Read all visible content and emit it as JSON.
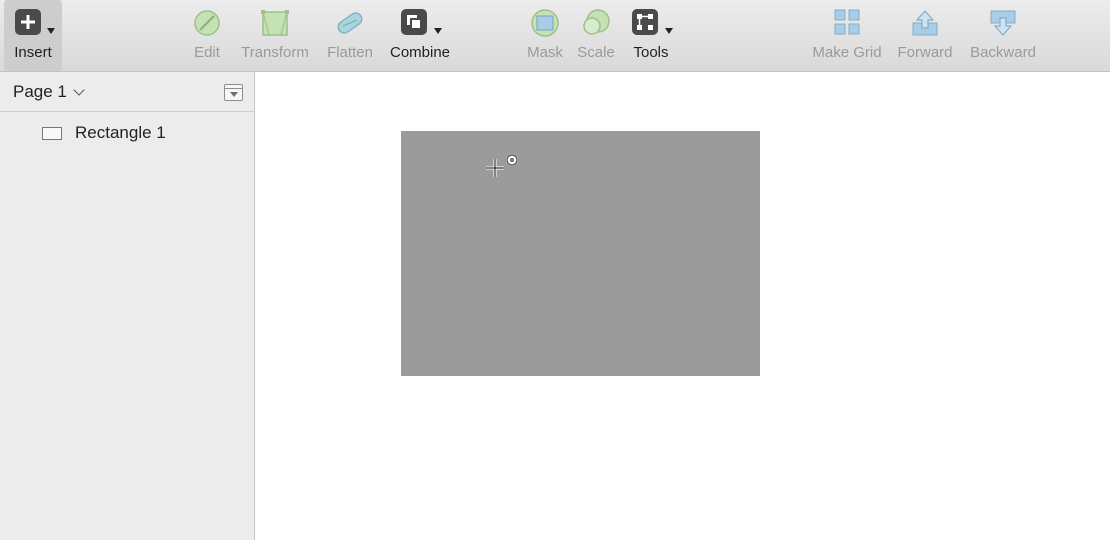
{
  "toolbar": {
    "insert": "Insert",
    "edit": "Edit",
    "transform": "Transform",
    "flatten": "Flatten",
    "combine": "Combine",
    "mask": "Mask",
    "scale": "Scale",
    "tools": "Tools",
    "make_grid": "Make Grid",
    "forward": "Forward",
    "backward": "Backward"
  },
  "sidebar": {
    "page": "Page 1",
    "layers": [
      {
        "label": "Rectangle 1",
        "type": "rectangle"
      }
    ]
  },
  "canvas": {
    "shape_fill": "#9b9b9b"
  },
  "colors": {
    "accent_green": "#a9d08e",
    "accent_blue": "#8fb8e0"
  }
}
